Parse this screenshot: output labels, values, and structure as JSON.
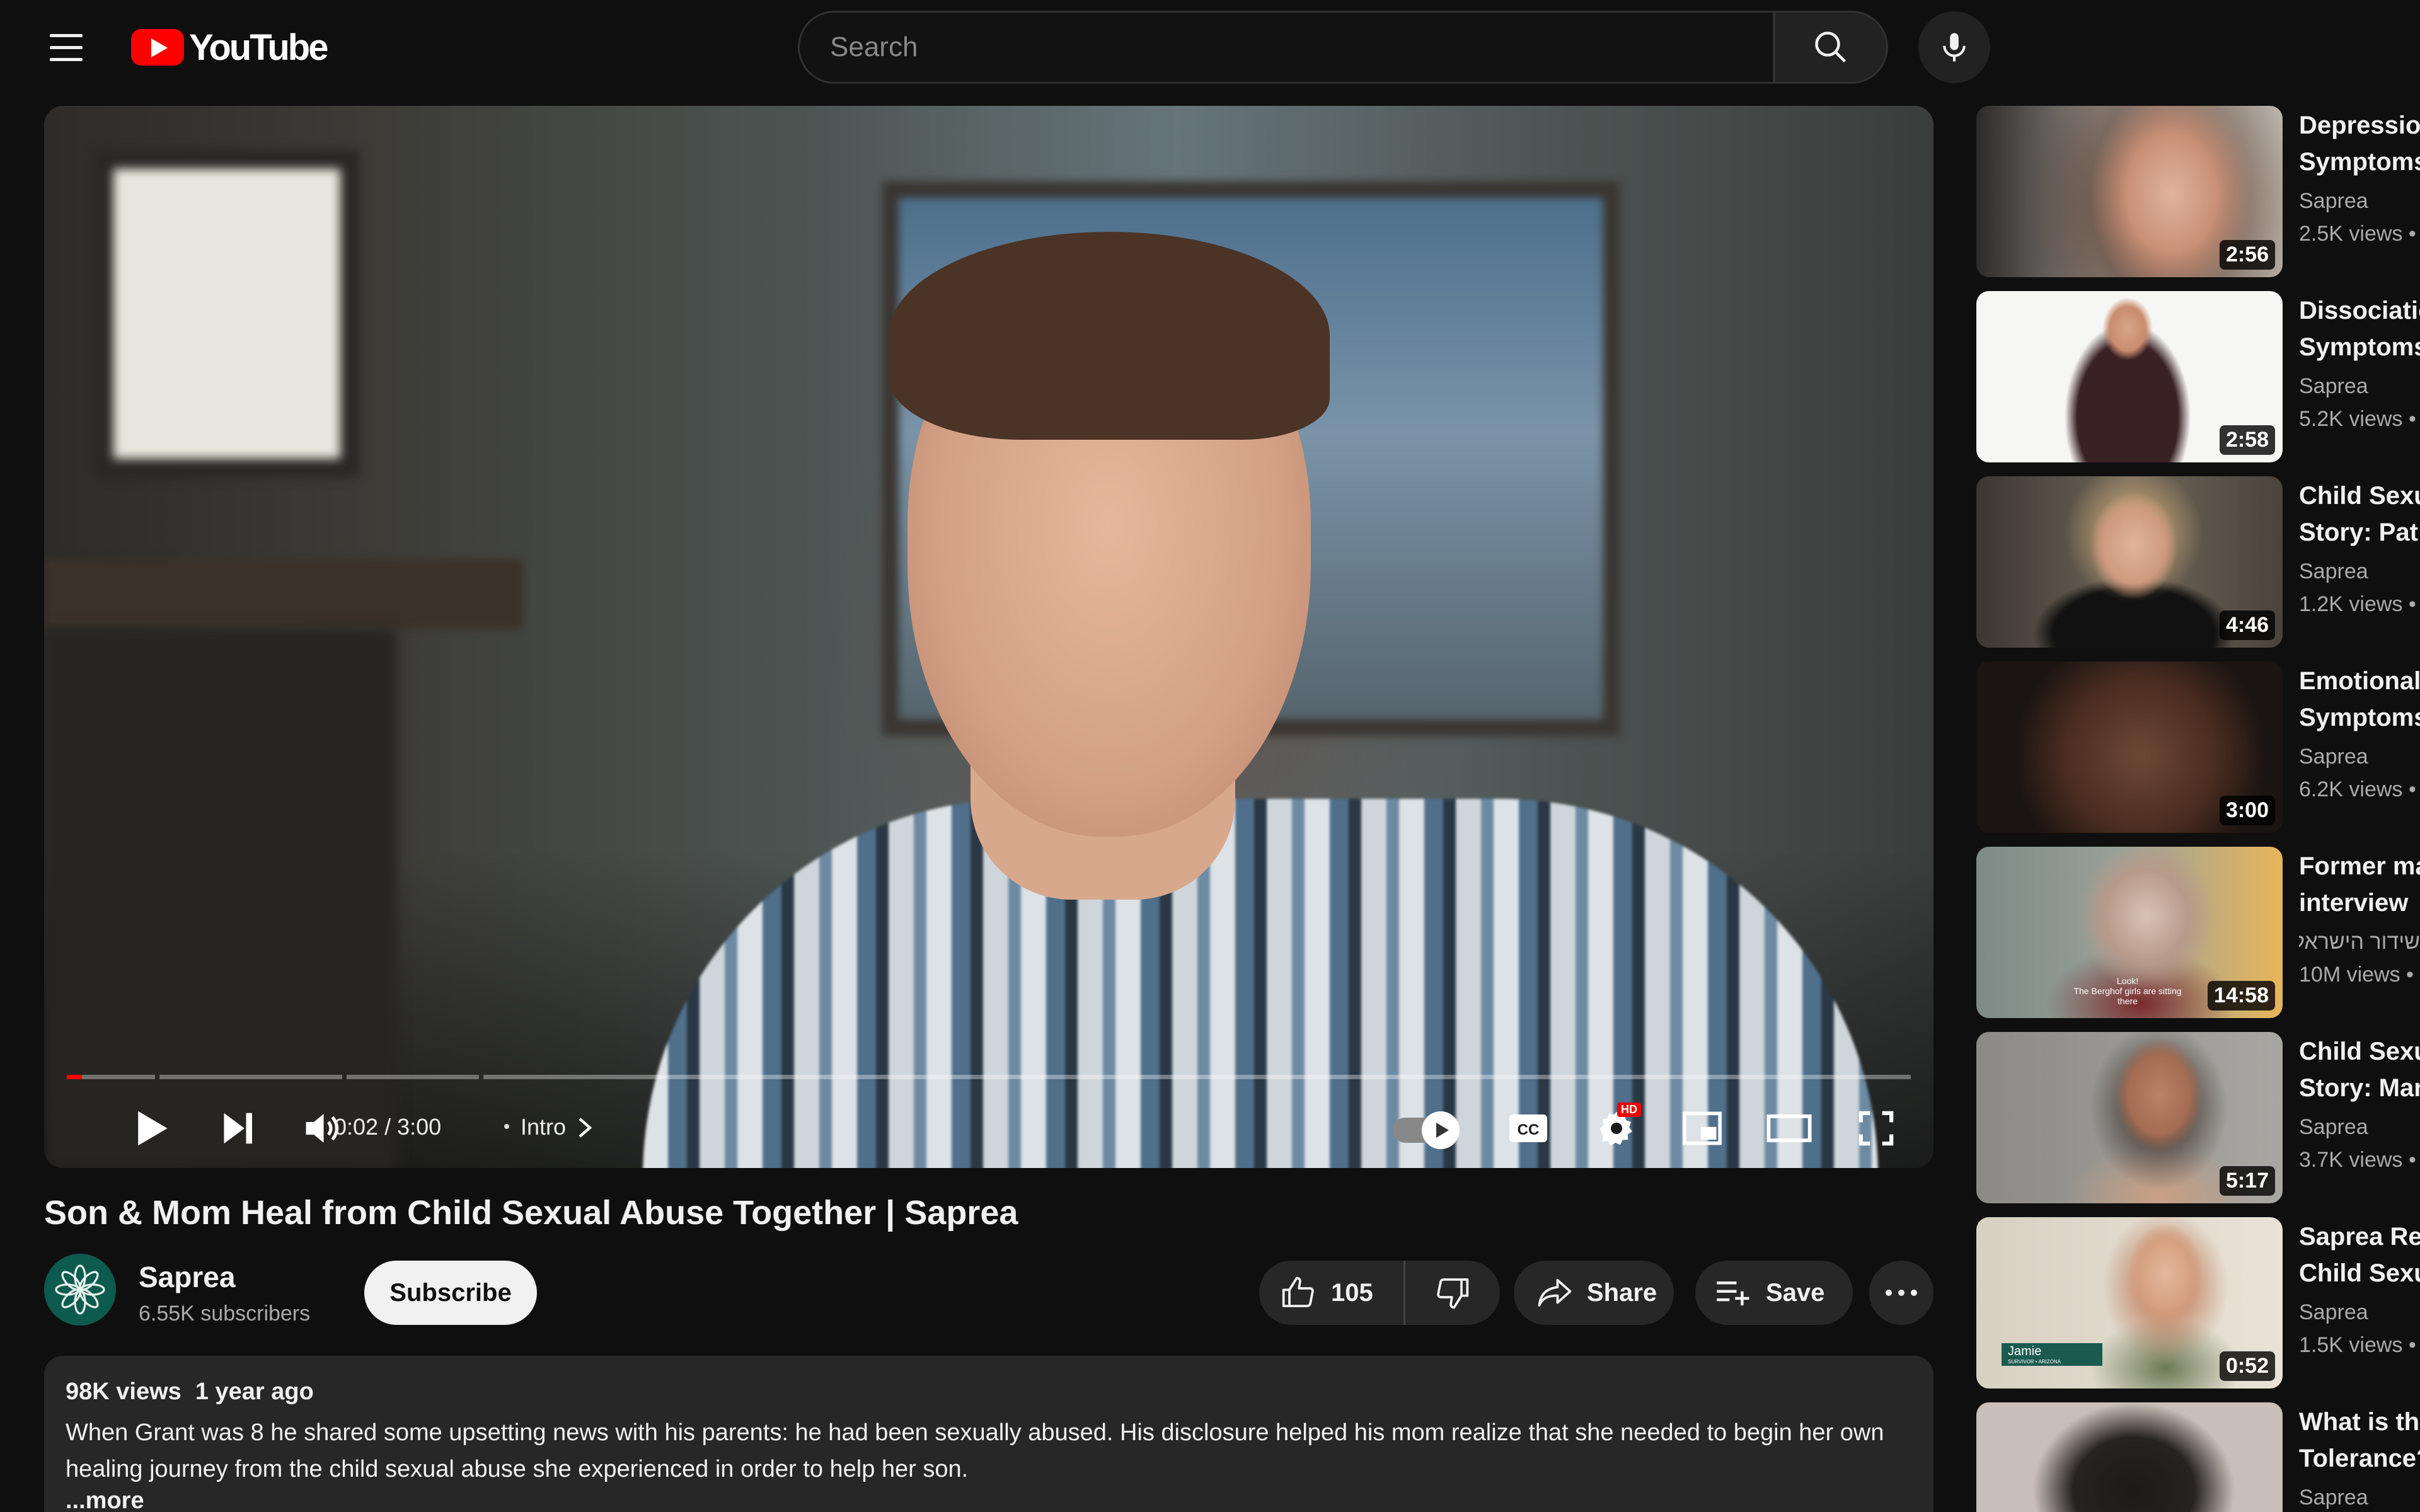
{
  "brand": {
    "logo_text": "YouTube",
    "accent": "#ff0000"
  },
  "search": {
    "placeholder": "Search"
  },
  "player": {
    "time": "0:02 / 3:00",
    "chapter": "Intro",
    "progress_fraction": 0.007,
    "hd_label": "HD",
    "cc_label": "CC"
  },
  "video": {
    "title": "Son & Mom Heal from Child Sexual Abuse Together | Saprea",
    "channel": "Saprea",
    "subscribers": "6.55K subscribers",
    "subscribe_label": "Subscribe",
    "likes": "105",
    "share_label": "Share",
    "save_label": "Save",
    "views": "98K views",
    "age": "1 year ago",
    "description": "When Grant was 8 he shared some upsetting news with his parents: he had been sexually abused. His disclosure helped his mom realize that she needed to begin her own healing journey from the child sexual abuse she experienced in order to help her son.",
    "more_label": "...more"
  },
  "recommendations": [
    {
      "title1": "Depression",
      "title2": "Symptoms",
      "channel": "Saprea",
      "views": "2.5K views •",
      "duration": "2:56"
    },
    {
      "title1": "Dissociatio",
      "title2": "Symptoms",
      "channel": "Saprea",
      "views": "5.2K views •",
      "duration": "2:58"
    },
    {
      "title1": "Child Sexu",
      "title2": "Story: Pat",
      "channel": "Saprea",
      "views": "1.2K views •",
      "duration": "4:46"
    },
    {
      "title1": "Emotional",
      "title2": "Symptoms",
      "channel": "Saprea",
      "views": "6.2K views •",
      "duration": "3:00"
    },
    {
      "title1": "Former ma",
      "title2": "interview",
      "channel": "שידור הישראלי",
      "views": "10M views •",
      "duration": "14:58"
    },
    {
      "title1": "Child Sexu",
      "title2": "Story: Mari",
      "channel": "Saprea",
      "views": "3.7K views •",
      "duration": "5:17"
    },
    {
      "title1": "Saprea Ret",
      "title2": "Child Sexu",
      "channel": "Saprea",
      "views": "1.5K views •",
      "duration": "0:52"
    },
    {
      "title1": "What is the",
      "title2": "Tolerance?",
      "channel": "Saprea",
      "views": "",
      "duration": ""
    }
  ],
  "thumb_captions": {
    "berghof_line1": "Look!",
    "berghof_line2": "The Berghof girls are sitting there",
    "jamie_name": "Jamie",
    "jamie_sub": "SURVIVOR • ARIZONA"
  },
  "icons": [
    "menu-icon",
    "search-icon",
    "mic-icon",
    "play-icon",
    "next-icon",
    "volume-icon",
    "chevron-right-icon",
    "autoplay-toggle",
    "cc-icon",
    "settings-icon",
    "miniplayer-icon",
    "theater-icon",
    "fullscreen-icon",
    "thumbs-up-icon",
    "thumbs-down-icon",
    "share-icon",
    "save-playlist-icon",
    "more-icon",
    "saprea-logo-icon"
  ]
}
